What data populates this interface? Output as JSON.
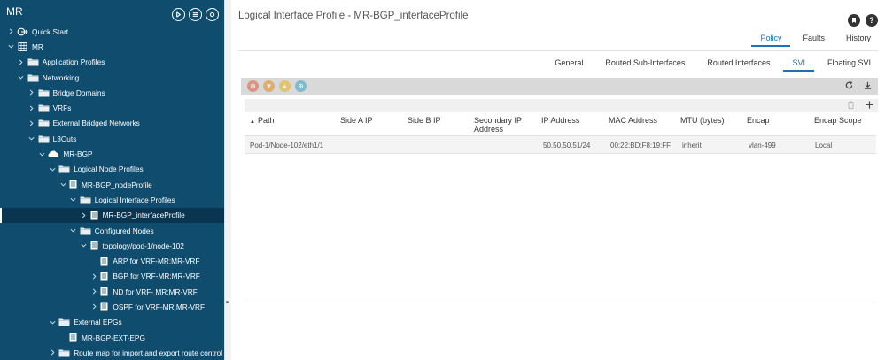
{
  "sidebar": {
    "title": "MR",
    "items": [
      {
        "label": "Quick Start",
        "indent": 0,
        "caret": "right",
        "icon": "quickstart"
      },
      {
        "label": "MR",
        "indent": 0,
        "caret": "down",
        "icon": "tenant"
      },
      {
        "label": "Application Profiles",
        "indent": 1,
        "caret": "right",
        "icon": "folder"
      },
      {
        "label": "Networking",
        "indent": 1,
        "caret": "down",
        "icon": "folder"
      },
      {
        "label": "Bridge Domains",
        "indent": 2,
        "caret": "right",
        "icon": "folder"
      },
      {
        "label": "VRFs",
        "indent": 2,
        "caret": "right",
        "icon": "folder"
      },
      {
        "label": "External Bridged Networks",
        "indent": 2,
        "caret": "right",
        "icon": "folder"
      },
      {
        "label": "L3Outs",
        "indent": 2,
        "caret": "down",
        "icon": "folder"
      },
      {
        "label": "MR-BGP",
        "indent": 3,
        "caret": "down",
        "icon": "cloud"
      },
      {
        "label": "Logical Node Profiles",
        "indent": 4,
        "caret": "down",
        "icon": "folder"
      },
      {
        "label": "MR-BGP_nodeProfile",
        "indent": 5,
        "caret": "down",
        "icon": "doc"
      },
      {
        "label": "Logical Interface Profiles",
        "indent": 6,
        "caret": "down",
        "icon": "folder"
      },
      {
        "label": "MR-BGP_interfaceProfile",
        "indent": 7,
        "caret": "right",
        "icon": "doc",
        "selected": true
      },
      {
        "label": "Configured Nodes",
        "indent": 6,
        "caret": "down",
        "icon": "folder"
      },
      {
        "label": "topology/pod-1/node-102",
        "indent": 7,
        "caret": "down",
        "icon": "doc"
      },
      {
        "label": "ARP for VRF-MR:MR-VRF",
        "indent": 8,
        "caret": "none",
        "icon": "doc"
      },
      {
        "label": "BGP for VRF-MR:MR-VRF",
        "indent": 8,
        "caret": "right",
        "icon": "doc"
      },
      {
        "label": "ND for VRF- MR:MR-VRF",
        "indent": 8,
        "caret": "right",
        "icon": "doc"
      },
      {
        "label": "OSPF for VRF-MR:MR-VRF",
        "indent": 8,
        "caret": "right",
        "icon": "doc"
      },
      {
        "label": "External EPGs",
        "indent": 4,
        "caret": "down",
        "icon": "folder"
      },
      {
        "label": "MR-BGP-EXT-EPG",
        "indent": 5,
        "caret": "none",
        "icon": "doc"
      },
      {
        "label": "Route map for import and export route control",
        "indent": 4,
        "caret": "right",
        "icon": "folder"
      }
    ]
  },
  "main": {
    "title": "Logical Interface Profile - MR-BGP_interfaceProfile",
    "tabs": [
      "Policy",
      "Faults",
      "History"
    ],
    "active_tab": "Policy",
    "subtabs": [
      "General",
      "Routed Sub-Interfaces",
      "Routed Interfaces",
      "SVI",
      "Floating SVI"
    ],
    "active_subtab": "SVI",
    "toolbar_colors": [
      "#e05a3a",
      "#e38b1c",
      "#e6b31c",
      "#2fa6c8"
    ],
    "table": {
      "columns": [
        "Path",
        "Side A IP",
        "Side B IP",
        "Secondary IP Address",
        "IP Address",
        "MAC Address",
        "MTU (bytes)",
        "Encap",
        "Encap Scope"
      ],
      "rows": [
        [
          "Pod-1/Node-102/eth1/1",
          "",
          "",
          "",
          "50.50.50.51/24",
          "00:22:BD:F8:19:FF",
          "inherit",
          "vlan-499",
          "Local"
        ]
      ]
    }
  }
}
